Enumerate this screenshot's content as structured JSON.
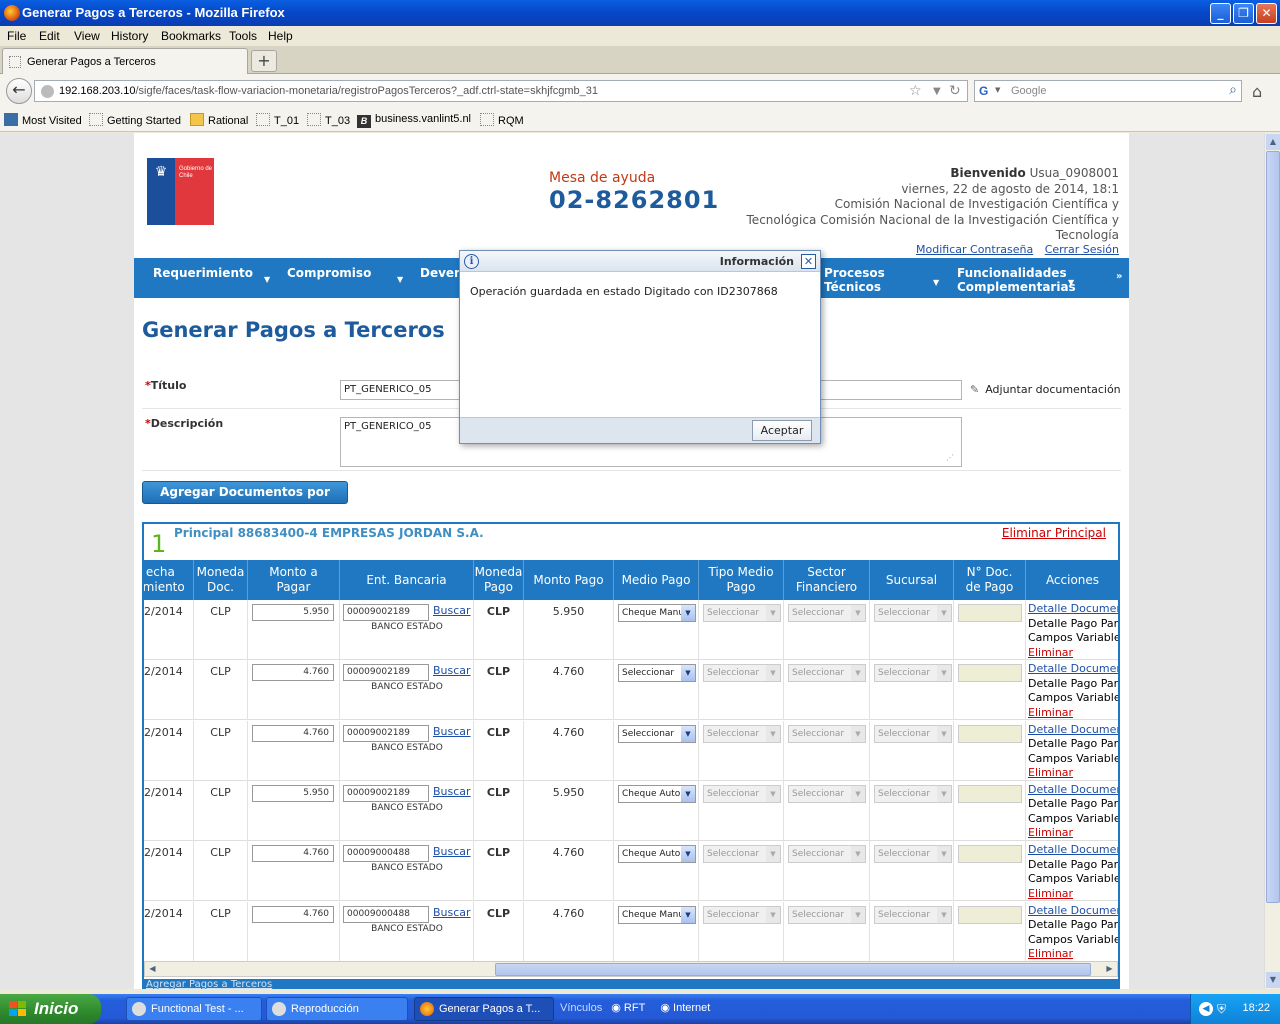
{
  "window": {
    "title": "Generar Pagos a Terceros - Mozilla Firefox"
  },
  "menu": [
    "File",
    "Edit",
    "View",
    "History",
    "Bookmarks",
    "Tools",
    "Help"
  ],
  "tab": {
    "label": "Generar Pagos a Terceros"
  },
  "navbar": {
    "url_host": "192.168.203.10",
    "url_path": "/sigfe/faces/task-flow-variacion-monetaria/registroPagosTerceros?_adf.ctrl-state=skhjfcgmb_31",
    "search_placeholder": "Google"
  },
  "bookmarks": [
    "Most Visited",
    "Getting Started",
    "Rational",
    "T_01",
    "T_03",
    "business.vanlint5.nl",
    "RQM"
  ],
  "header": {
    "logo_text": "Gobierno de Chile",
    "helpdesk_label": "Mesa de ayuda",
    "helpdesk_phone": "02-8262801",
    "welcome_label": "Bienvenido",
    "username": "Usua_0908001",
    "date": "viernes, 22 de agosto de 2014, 18:1",
    "org_line1": "Comisión Nacional de Investigación Científica y",
    "org_line2": "Tecnológica Comisión Nacional de la Investigación Científica y",
    "org_line3": "Tecnología",
    "change_password": "Modificar Contraseña",
    "logout": "Cerrar Sesión"
  },
  "mainnav": {
    "items": [
      "Requerimiento",
      "Compromiso",
      "Deven"
    ],
    "item4_line1": "Procesos",
    "item4_line2": "Técnicos",
    "item5_line1": "Funcionalidades",
    "item5_line2": "Complementarias"
  },
  "page": {
    "title": "Generar Pagos a Terceros",
    "titulo_label": "Título",
    "titulo_value": "PT_GENERICO_05",
    "descripcion_label": "Descripción",
    "descripcion_value": "PT_GENERICO_05",
    "attach_label": "Adjuntar documentación",
    "add_docs_button": "Agregar Documentos por Pagar"
  },
  "principal": {
    "number": "1",
    "title": "Principal 88683400-4 EMPRESAS JORDAN S.A.",
    "delete_label": "Eliminar Principal"
  },
  "grid": {
    "headers": [
      [
        "echa",
        "limiento"
      ],
      [
        "Moneda",
        "Doc."
      ],
      [
        "Monto a",
        "Pagar"
      ],
      [
        "Ent. Bancaria",
        ""
      ],
      [
        "Moneda",
        "Pago"
      ],
      [
        "Monto Pago",
        ""
      ],
      [
        "Medio Pago",
        ""
      ],
      [
        "Tipo Medio",
        "Pago"
      ],
      [
        "Sector",
        "Financiero"
      ],
      [
        "Sucursal",
        ""
      ],
      [
        "N° Doc.",
        "de Pago"
      ],
      [
        "Acciones",
        ""
      ]
    ],
    "buscar_label": "Buscar",
    "select_placeholder": "Seleccionar",
    "actions": [
      "Detalle Documento",
      "Detalle Pago Parcial",
      "Campos Variables",
      "Eliminar"
    ],
    "rows": [
      {
        "fecha": "2/2014",
        "moneda_doc": "CLP",
        "monto": "5.950",
        "cuenta": "00009002189",
        "banco": "BANCO ESTADO",
        "moneda_pago": "CLP",
        "monto_pago": "5.950",
        "medio": "Cheque Manu"
      },
      {
        "fecha": "2/2014",
        "moneda_doc": "CLP",
        "monto": "4.760",
        "cuenta": "00009002189",
        "banco": "BANCO ESTADO",
        "moneda_pago": "CLP",
        "monto_pago": "4.760",
        "medio": "Seleccionar"
      },
      {
        "fecha": "2/2014",
        "moneda_doc": "CLP",
        "monto": "4.760",
        "cuenta": "00009002189",
        "banco": "BANCO ESTADO",
        "moneda_pago": "CLP",
        "monto_pago": "4.760",
        "medio": "Seleccionar"
      },
      {
        "fecha": "2/2014",
        "moneda_doc": "CLP",
        "monto": "5.950",
        "cuenta": "00009002189",
        "banco": "BANCO ESTADO",
        "moneda_pago": "CLP",
        "monto_pago": "5.950",
        "medio": "Cheque Autor"
      },
      {
        "fecha": "2/2014",
        "moneda_doc": "CLP",
        "monto": "4.760",
        "cuenta": "00009000488",
        "banco": "BANCO ESTADO",
        "moneda_pago": "CLP",
        "monto_pago": "4.760",
        "medio": "Cheque Autor"
      },
      {
        "fecha": "2/2014",
        "moneda_doc": "CLP",
        "monto": "4.760",
        "cuenta": "00009000488",
        "banco": "BANCO ESTADO",
        "moneda_pago": "CLP",
        "monto_pago": "4.760",
        "medio": "Cheque Manu"
      }
    ],
    "footer_link": "Agregar Pagos a Terceros"
  },
  "modal": {
    "title": "Información",
    "message": "Operación guardada en estado Digitado con ID2307868",
    "ok_button": "Aceptar"
  },
  "taskbar": {
    "start": "Inicio",
    "buttons": [
      "Functional Test - ...",
      "Reproducción",
      "Generar Pagos a T..."
    ],
    "quicklinks": [
      "Vínculos",
      "RFT",
      "Internet"
    ],
    "clock": "18:22"
  },
  "colors": {
    "accent_blue": "#1f78c1",
    "title_blue": "#1d5b9c",
    "danger_red": "#cc0000",
    "success_green": "#5cb51c"
  }
}
